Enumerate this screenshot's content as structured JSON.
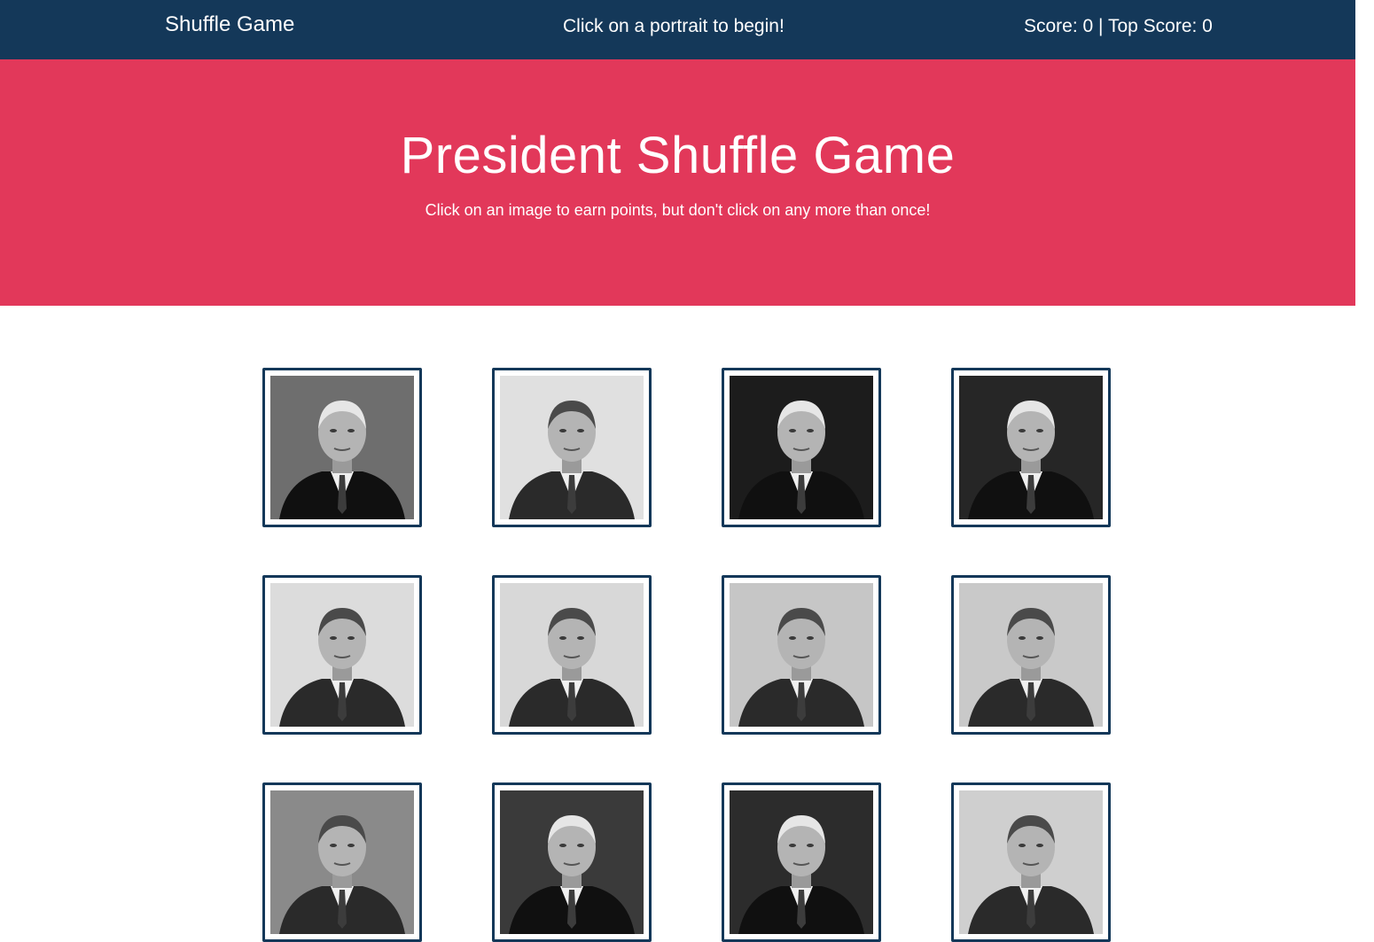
{
  "navbar": {
    "brand": "Shuffle Game",
    "message": "Click on a portrait to begin!",
    "score_text": "Score: 0 | Top Score: 0"
  },
  "hero": {
    "title": "President Shuffle Game",
    "subtitle": "Click on an image to earn points, but don't click on any more than once!"
  },
  "game": {
    "score": 0,
    "top_score": 0,
    "cards": [
      {
        "id": 1,
        "bg": "#6e6e6e"
      },
      {
        "id": 2,
        "bg": "#e0e0e0"
      },
      {
        "id": 3,
        "bg": "#1c1c1c"
      },
      {
        "id": 4,
        "bg": "#262626"
      },
      {
        "id": 5,
        "bg": "#dcdcdc"
      },
      {
        "id": 6,
        "bg": "#d8d8d8"
      },
      {
        "id": 7,
        "bg": "#c6c6c6"
      },
      {
        "id": 8,
        "bg": "#c9c9c9"
      },
      {
        "id": 9,
        "bg": "#8a8a8a"
      },
      {
        "id": 10,
        "bg": "#3a3a3a"
      },
      {
        "id": 11,
        "bg": "#2c2c2c"
      },
      {
        "id": 12,
        "bg": "#cfcfcf"
      }
    ]
  },
  "colors": {
    "navbar": "#143859",
    "hero": "#e2385a",
    "card_border": "#143859"
  }
}
